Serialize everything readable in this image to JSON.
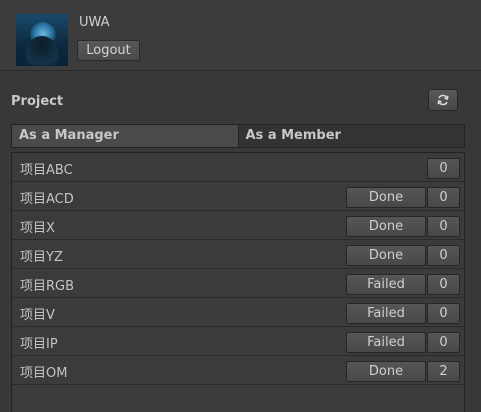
{
  "user": {
    "name": "UWA",
    "logout_label": "Logout"
  },
  "project": {
    "label": "Project",
    "refresh_icon": "refresh-icon"
  },
  "tabs": [
    {
      "label": "As a Manager",
      "active": true
    },
    {
      "label": "As a Member",
      "active": false
    }
  ],
  "projects": [
    {
      "name": "项目ABC",
      "status": "",
      "count": "0"
    },
    {
      "name": "项目ACD",
      "status": "Done",
      "count": "0"
    },
    {
      "name": "项目X",
      "status": "Done",
      "count": "0"
    },
    {
      "name": "项目YZ",
      "status": "Done",
      "count": "0"
    },
    {
      "name": "项目RGB",
      "status": "Failed",
      "count": "0"
    },
    {
      "name": "项目V",
      "status": "Failed",
      "count": "0"
    },
    {
      "name": "项目IP",
      "status": "Failed",
      "count": "0"
    },
    {
      "name": "项目OM",
      "status": "Done",
      "count": "2"
    }
  ]
}
